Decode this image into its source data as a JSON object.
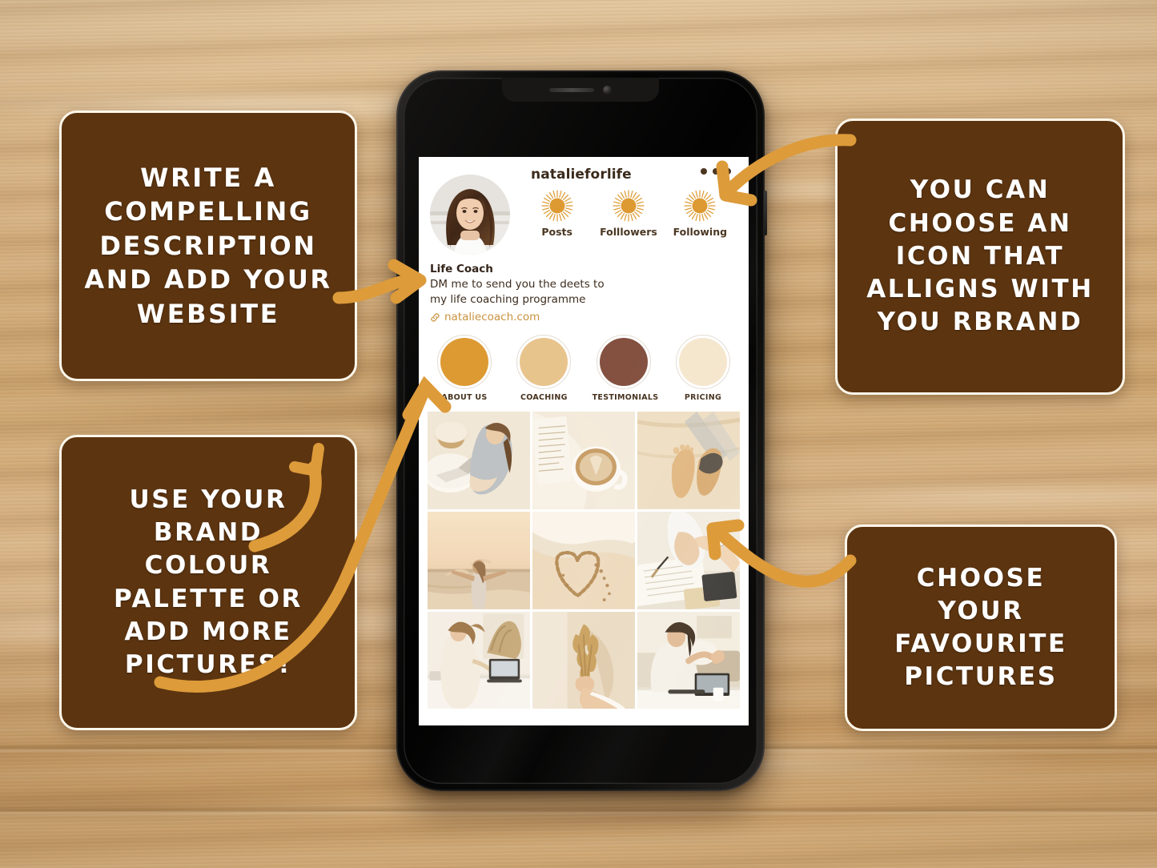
{
  "background": {
    "surface": "wood-desk",
    "wood_light": "#ddbd8f",
    "wood_mid": "#cfa771",
    "wood_dark": "#b98f57"
  },
  "theme": {
    "callout_bg": "#5C3410",
    "callout_border": "#FDF6EA",
    "callout_text": "#FFFFFF",
    "arrow_color": "#DD9B3A",
    "brand_orange": "#DD9A33",
    "brand_tan": "#E8C48D",
    "brand_brown": "#845140",
    "brand_cream": "#F5E6CC",
    "link_text": "#C9923F"
  },
  "callouts": [
    {
      "id": "top-left",
      "name": "write-description-callout",
      "text": "WRITE A\nCOMPELLING\nDESCRIPTION\nAND ADD YOUR\nWEBSITE"
    },
    {
      "id": "bottom-left",
      "name": "brand-colour-callout",
      "text": "USE YOUR\nBRAND\nCOLOUR\nPALETTE OR\nADD MORE\nPICTURES!"
    },
    {
      "id": "top-right",
      "name": "choose-icon-callout",
      "text": "YOU CAN\nCHOOSE AN\nICON THAT\nALLIGNS WITH\nYOU RBRAND"
    },
    {
      "id": "bottom-right",
      "name": "favourite-pictures-callout",
      "text": "CHOOSE\nYOUR\nFAVOURITE\nPICTURES"
    }
  ],
  "arrows": [
    {
      "name": "arrow-to-bio",
      "from": "top-left-callout",
      "to": "profile-bio",
      "direction": "right"
    },
    {
      "name": "arrow-to-highlights",
      "from": "bottom-left-callout",
      "to": "story-highlights",
      "direction": "up-right"
    },
    {
      "name": "arrow-to-menu-dots",
      "from": "top-right-callout",
      "to": "profile-menu-dots",
      "direction": "down-left"
    },
    {
      "name": "arrow-to-photo-grid",
      "from": "bottom-right-callout",
      "to": "photo-grid",
      "direction": "up-left"
    }
  ],
  "device": {
    "name": "smartphone-mockup",
    "body_color": "#0A0A09",
    "orientation": "portrait"
  },
  "profile": {
    "username": "natalieforlife",
    "menu_icon": "three-dots-icon",
    "avatar_alt": "profile-photo-woman-smiling",
    "stats": [
      {
        "icon": "sun-icon",
        "label": "Posts"
      },
      {
        "icon": "sun-icon",
        "label": "Folllowers"
      },
      {
        "icon": "sun-icon",
        "label": "Following"
      }
    ],
    "bio": {
      "title": "Life Coach",
      "lines": [
        "DM me to send you the deets to",
        "my life coaching programme"
      ],
      "link_icon": "link-chain-icon",
      "link": "nataliecoach.com"
    },
    "highlights": [
      {
        "label": "ABOUT US",
        "color": "#DD9A33"
      },
      {
        "label": "COACHING",
        "color": "#E8C48D"
      },
      {
        "label": "TESTIMONIALS",
        "color": "#845140"
      },
      {
        "label": "PRICING",
        "color": "#F5E6CC"
      }
    ],
    "grid": [
      {
        "alt": "woman-working-laptop-white-table"
      },
      {
        "alt": "open-book-latte-cup-linen"
      },
      {
        "alt": "bare-feet-on-sandy-beach"
      },
      {
        "alt": "woman-arms-open-at-sunset-beach"
      },
      {
        "alt": "heart-drawn-in-sand"
      },
      {
        "alt": "hands-writing-in-notebook-with-watch"
      },
      {
        "alt": "woman-in-cream-dress-at-vanity-with-laptop"
      },
      {
        "alt": "hand-holding-dried-flowers"
      },
      {
        "alt": "woman-waving-at-laptop-video-call"
      }
    ]
  }
}
